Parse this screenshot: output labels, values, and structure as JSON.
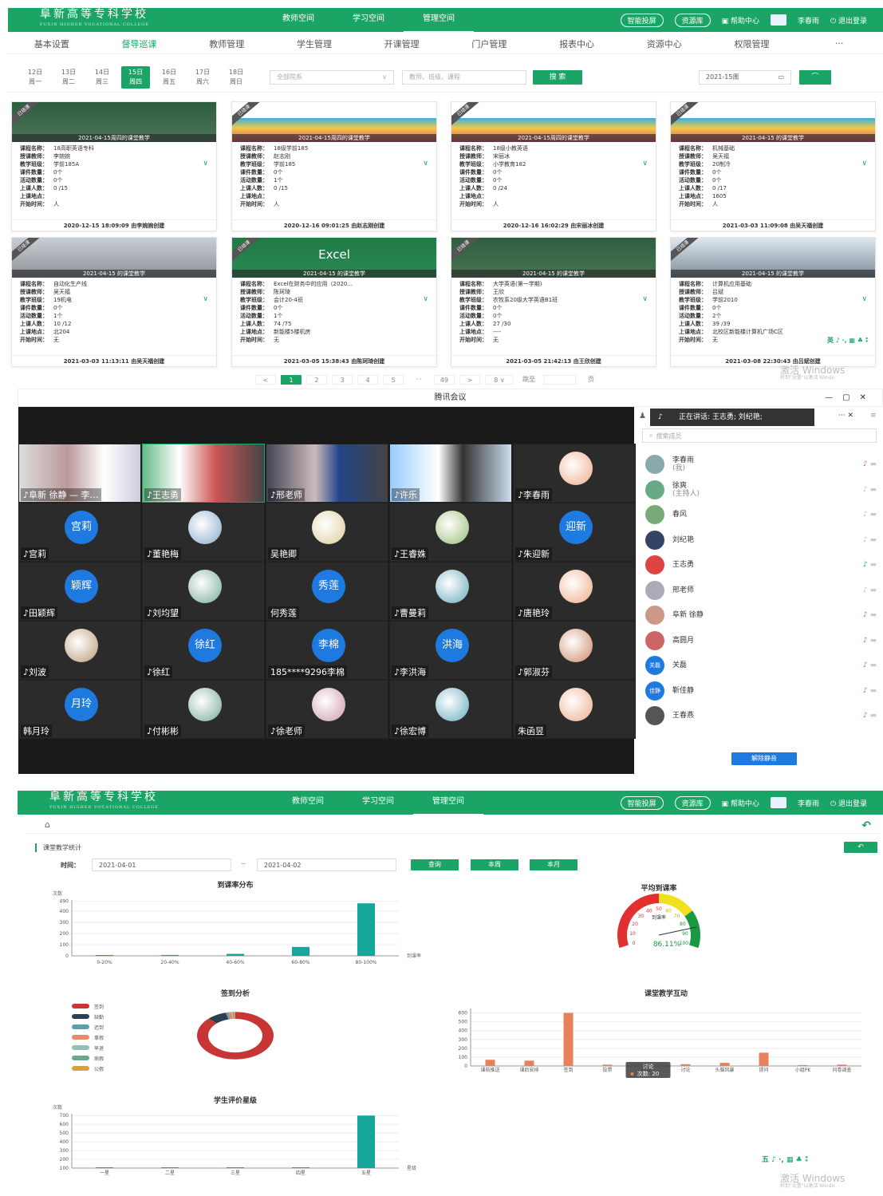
{
  "top": {
    "logo": "阜新高等专科学校",
    "logo_sub": "FUXIN HIGHER VOCATIONAL COLLEGE",
    "nav": [
      "教师空间",
      "学习空间",
      "管理空间"
    ],
    "active_nav": "管理空间",
    "btn_smart": "智能投屏",
    "btn_resource": "资源库",
    "help": "帮助中心",
    "user1": "李春雨",
    "logout": "退出登录"
  },
  "subnav": [
    "基本设置",
    "督导巡课",
    "教师管理",
    "学生管理",
    "开课管理",
    "门户管理",
    "报表中心",
    "资源中心",
    "权限管理",
    "···"
  ],
  "days": [
    {
      "d": "12日",
      "w": "周一"
    },
    {
      "d": "13日",
      "w": "周二"
    },
    {
      "d": "14日",
      "w": "周三"
    },
    {
      "d": "15日",
      "w": "周四"
    },
    {
      "d": "16日",
      "w": "周五"
    },
    {
      "d": "17日",
      "w": "周六"
    },
    {
      "d": "18日",
      "w": "周日"
    }
  ],
  "filters": {
    "dept": "全部院系",
    "search_ph": "教师、班级、课程",
    "search_btn": "搜 索",
    "week": "2021-15周"
  },
  "labels": {
    "course": "课程名称：",
    "teacher": "授课教师：",
    "class": "教学班级：",
    "ware": "课件数量：",
    "activity": "活动数量：",
    "people": "上课人数：",
    "place": "上课地点：",
    "start": "开始时间："
  },
  "ribbon": "已结课",
  "cards": [
    {
      "cap": "2021-04-15周四的课堂教学",
      "course": "18高职英语专科",
      "teacher": "李婉婉",
      "class": "学前185A",
      "ware": "0个",
      "activity": "0个",
      "people": "0 /15",
      "place": "",
      "start": "人",
      "foot": "2020-12-15 18:09:09 由李婉婉创建"
    },
    {
      "cap": "2021-04-15周四的课堂教学",
      "course": "18级学前185",
      "teacher": "赵志刚",
      "class": "学前185",
      "ware": "0个",
      "activity": "1个",
      "people": "0 /15",
      "place": "",
      "start": "人",
      "foot": "2020-12-16 09:01:25 由赵志刚创建"
    },
    {
      "cap": "2021-04-15周四的课堂教学",
      "course": "18级小教英语",
      "teacher": "宋丽冰",
      "class": "小学教育182",
      "ware": "0个",
      "activity": "0个",
      "people": "0 /24",
      "place": "",
      "start": "人",
      "foot": "2020-12-16 16:02:29 由宋丽冰创建"
    },
    {
      "cap": "2021-04-15 的课堂教学",
      "course": "机械基础",
      "teacher": "吴天福",
      "class": "20制冷",
      "ware": "0个",
      "activity": "0个",
      "people": "0 /17",
      "place": "1605",
      "start": "人",
      "foot": "2021-03-03 11:09:08 由吴天福创建"
    },
    {
      "cap": "2021-04-15 的课堂教学",
      "course": "自动化生产线",
      "teacher": "吴天福",
      "class": "19机电",
      "ware": "0个",
      "activity": "1个",
      "people": "10 /12",
      "place": "北204",
      "start": "无",
      "foot": "2021-03-03 11:13:11 由吴天福创建"
    },
    {
      "cap": "2021-04-15 的课堂教学",
      "course": "Excel在财务中的应用（2020...",
      "teacher": "陈珂琦",
      "class": "会计20-4班",
      "ware": "0个",
      "activity": "1个",
      "people": "74 /75",
      "place": "新能楼5楼机房",
      "start": "无",
      "foot": "2021-03-05 15:38:43 由陈珂琦创建"
    },
    {
      "cap": "2021-04-15 的课堂教学",
      "course": "大学英语(第一学期)",
      "teacher": "王欣",
      "class": "农牧系20级大学英语B1班",
      "ware": "0个",
      "activity": "0个",
      "people": "27 /30",
      "place": "----",
      "start": "无",
      "foot": "2021-03-05 21:42:13 由王欣创建"
    },
    {
      "cap": "2021-04-15 的课堂教学",
      "course": "计算机应用基础",
      "teacher": "吕斌",
      "class": "学前2010",
      "ware": "0个",
      "activity": "2个",
      "people": "39 /39",
      "place": "北校区新能楼计算机广场C区",
      "start": "无",
      "foot": "2021-03-08 22:30:43 由吕斌创建"
    }
  ],
  "excel_word": "Excel",
  "pager": [
    "<",
    "1",
    "2",
    "3",
    "4",
    "5",
    "···",
    "49",
    ">",
    "8 ∨",
    "跳至",
    "",
    "页"
  ],
  "watermark": {
    "main": "激活 Windows",
    "sub": "转到\"设置\"以激活 Windo"
  },
  "ime": "五 ♪ ·, ▦ ♣ ⁑",
  "ime2": "英 ♪ ·, ▦ ♣ ⁑",
  "meeting": {
    "title": "腾讯会议",
    "speaking": "正在讲话: 王志勇; 刘纪艳;",
    "member_search": "搜索成员",
    "unmute": "解除静音",
    "tiles": [
      "阜新 徐静 — 李…",
      "王志勇",
      "邢老师",
      "许乐",
      "李春雨",
      "宫莉",
      "董艳梅",
      "吴艳卿",
      "王睿姝",
      "朱迎新",
      "田颖辉",
      "刘均望",
      "何秀莲",
      "曹曼莉",
      "唐艳玲",
      "刘波",
      "徐红",
      "185****9296李棉",
      "李洪海",
      "郭淑芬",
      "韩月玲",
      "付彬彬",
      "徐老师",
      "徐宏博",
      "朱函昱"
    ],
    "circles": {
      "宫莉": "宫莉",
      "朱迎新": "迎新",
      "田颖辉": "颖辉",
      "何秀莲": "秀莲",
      "徐红": "徐红",
      "185****9296李棉": "李棉",
      "李洪海": "洪海",
      "韩月玲": "月玲"
    },
    "members": [
      {
        "name": "李春雨",
        "sub": "(我)",
        "mic": "red"
      },
      {
        "name": "徐爽",
        "sub": "(主持人)",
        "mic": "grey"
      },
      {
        "name": "春风",
        "sub": "",
        "mic": "grey"
      },
      {
        "name": "刘纪艳",
        "sub": "",
        "mic": "grey"
      },
      {
        "name": "王志勇",
        "sub": "",
        "mic": "green"
      },
      {
        "name": "邢老师",
        "sub": "",
        "mic": "grey"
      },
      {
        "name": "阜新 徐静",
        "sub": "",
        "mic": "red"
      },
      {
        "name": "高圆月",
        "sub": "",
        "mic": "red"
      },
      {
        "name": "关磊",
        "sub": "",
        "mic": "red",
        "av": "关磊"
      },
      {
        "name": "靳佳静",
        "sub": "",
        "mic": "red",
        "av": "佳静"
      },
      {
        "name": "王春燕",
        "sub": "",
        "mic": "red"
      }
    ]
  },
  "stats": {
    "breadcrumb_home": "⌂",
    "section": "课堂教学统计",
    "time_label": "时间：",
    "from": "2021-04-01",
    "tilde": "~",
    "to": "2021-04-02",
    "btn_query": "查询",
    "btn_week": "本周",
    "btn_month": "本月"
  },
  "chart_data": [
    {
      "type": "bar",
      "title": "到课率分布",
      "ylabel": "次数",
      "xlabel": "到课率",
      "categories": [
        "0-20%",
        "20-40%",
        "40-60%",
        "60-80%",
        "80-100%"
      ],
      "values": [
        5,
        8,
        18,
        80,
        470
      ],
      "ylim": [
        0,
        500
      ],
      "yticks": [
        0,
        100,
        200,
        300,
        400,
        490
      ],
      "color": "#17a69b"
    },
    {
      "type": "gauge",
      "title": "平均到课率",
      "label": "到课率",
      "value": 86.11,
      "display": "86.11%",
      "ticks": [
        0,
        10,
        20,
        30,
        40,
        50,
        60,
        70,
        80,
        90,
        100
      ]
    },
    {
      "type": "pie",
      "title": "签到分析",
      "series": [
        {
          "name": "签到",
          "value": 88,
          "color": "#c83535"
        },
        {
          "name": "缺勤",
          "value": 8,
          "color": "#2b3f55"
        },
        {
          "name": "迟到",
          "value": 1,
          "color": "#5aa0a8"
        },
        {
          "name": "事假",
          "value": 1.5,
          "color": "#e8896a"
        },
        {
          "name": "早退",
          "value": 0.5,
          "color": "#8fc1b6"
        },
        {
          "name": "病假",
          "value": 0.5,
          "color": "#6aa889"
        },
        {
          "name": "公假",
          "value": 0.5,
          "color": "#d8a040"
        }
      ]
    },
    {
      "type": "bar",
      "title": "课堂教学互动",
      "categories": [
        "课前推送",
        "课后安排",
        "签到",
        "投票",
        "讨论",
        "讨论",
        "头脑风暴",
        "提问",
        "小组PK",
        "问卷调查"
      ],
      "values": [
        70,
        60,
        600,
        15,
        20,
        20,
        35,
        150,
        10,
        15
      ],
      "ylim": [
        0,
        650
      ],
      "yticks": [
        0,
        100,
        200,
        300,
        400,
        500,
        600
      ],
      "tooltip": {
        "title": "讨论",
        "text": "次数: 20"
      },
      "color": "#e8805a"
    },
    {
      "type": "bar",
      "title": "学生评价星级",
      "ylabel": "次数",
      "xlabel": "星级",
      "categories": [
        "一星",
        "二星",
        "三星",
        "四星",
        "五星"
      ],
      "values": [
        0,
        0,
        0,
        0,
        700
      ],
      "ylim": [
        100,
        720
      ],
      "yticks": [
        100,
        200,
        300,
        400,
        500,
        600,
        700
      ],
      "color": "#17a69b"
    }
  ]
}
